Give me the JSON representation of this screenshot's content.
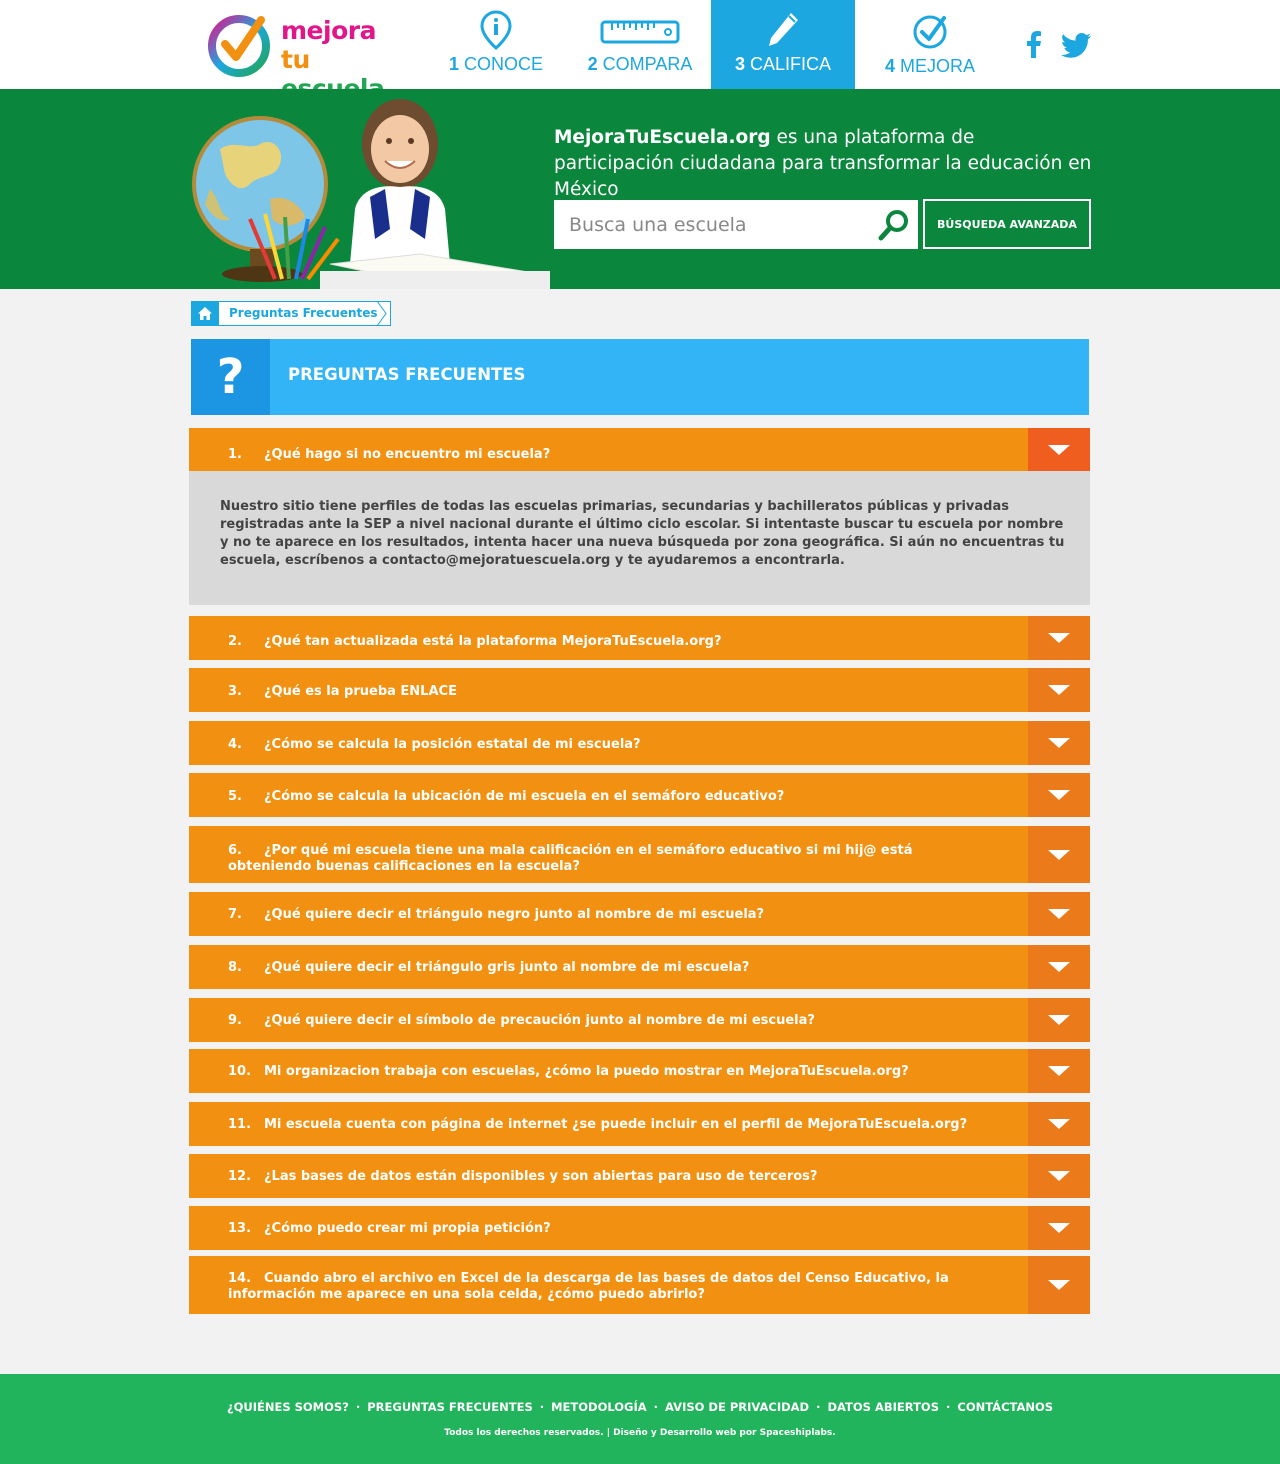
{
  "logo": {
    "line1": "mejora",
    "line2_a": "tu",
    "line2_b": " escuela"
  },
  "nav": [
    {
      "num": "1",
      "label": "CONOCE"
    },
    {
      "num": "2",
      "label": "COMPARA"
    },
    {
      "num": "3",
      "label": "CALIFICA"
    },
    {
      "num": "4",
      "label": "MEJORA"
    }
  ],
  "social": [
    "facebook-icon",
    "twitter-icon"
  ],
  "hero": {
    "brand": "MejoraTuEscuela.org",
    "tagline": " es una plataforma de participación ciudadana para transformar la educación en México",
    "search_placeholder": "Busca una escuela",
    "advanced_search": "BÚSQUEDA AVANZADA"
  },
  "breadcrumb": {
    "current": "Preguntas Frecuentes"
  },
  "page_title": "PREGUNTAS FRECUENTES",
  "title_icon": "?",
  "faq": [
    {
      "num": "1.",
      "q": "¿Qué hago si no encuentro mi escuela?",
      "open": true,
      "answer": "Nuestro sitio tiene perfiles de todas las escuelas primarias, secundarias y bachilleratos públicas y privadas registradas ante la SEP a nivel nacional durante el último ciclo escolar. Si intentaste buscar tu escuela por nombre y no te aparece en los resultados, intenta hacer una nueva búsqueda por zona geográfica. Si aún no encuentras tu escuela, escríbenos a contacto@mejoratuescuela.org y te ayudaremos a encontrarla."
    },
    {
      "num": "2.",
      "q": "¿Qué tan actualizada está la plataforma MejoraTuEscuela.org?"
    },
    {
      "num": "3.",
      "q": "¿Qué es la prueba ENLACE"
    },
    {
      "num": "4.",
      "q": "¿Cómo se calcula la posición estatal de mi escuela?"
    },
    {
      "num": "5.",
      "q": "¿Cómo se calcula la ubicación de mi escuela en el semáforo educativo?"
    },
    {
      "num": "6.",
      "q": "¿Por qué mi escuela tiene una mala calificación en el semáforo educativo si mi hij@ está obteniendo buenas calificaciones en la escuela?"
    },
    {
      "num": "7.",
      "q": "¿Qué quiere decir el triángulo negro junto al nombre de mi escuela?"
    },
    {
      "num": "8.",
      "q": "¿Qué quiere decir el triángulo gris junto al nombre de mi escuela?"
    },
    {
      "num": "9.",
      "q": "¿Qué quiere decir el símbolo de precaución junto al nombre de mi escuela?"
    },
    {
      "num": "10.",
      "q": "Mi organizacion trabaja con escuelas, ¿cómo la puedo mostrar en MejoraTuEscuela.org?"
    },
    {
      "num": "11.",
      "q": "Mi escuela cuenta con página de internet ¿se puede incluir en el perfil de MejoraTuEscuela.org?"
    },
    {
      "num": "12.",
      "q": "¿Las bases de datos están disponibles y son abiertas para uso de terceros?"
    },
    {
      "num": "13.",
      "q": "¿Cómo puedo crear mi propia petición?"
    },
    {
      "num": "14.",
      "q": "Cuando abro el archivo en Excel de la descarga de las bases de datos del Censo Educativo, la información me aparece en una sola celda, ¿cómo puedo abrirlo?"
    }
  ],
  "footer": {
    "links": [
      "¿QUIÉNES SOMOS?",
      "PREGUNTAS FRECUENTES",
      "METODOLOGÍA",
      "AVISO DE PRIVACIDAD",
      "DATOS ABIERTOS",
      "CONTÁCTANOS"
    ],
    "separator": "·",
    "copyright": "Todos los derechos reservados. | Diseño y Desarrollo web por Spaceshiplabs."
  },
  "colors": {
    "header_blue": "#1da7e0",
    "hero_green": "#0b873d",
    "faq_orange": "#f29111",
    "faq_toggle": "#eb7a1b",
    "title_blue": "#33b4f6",
    "footer_green": "#22b45c"
  }
}
